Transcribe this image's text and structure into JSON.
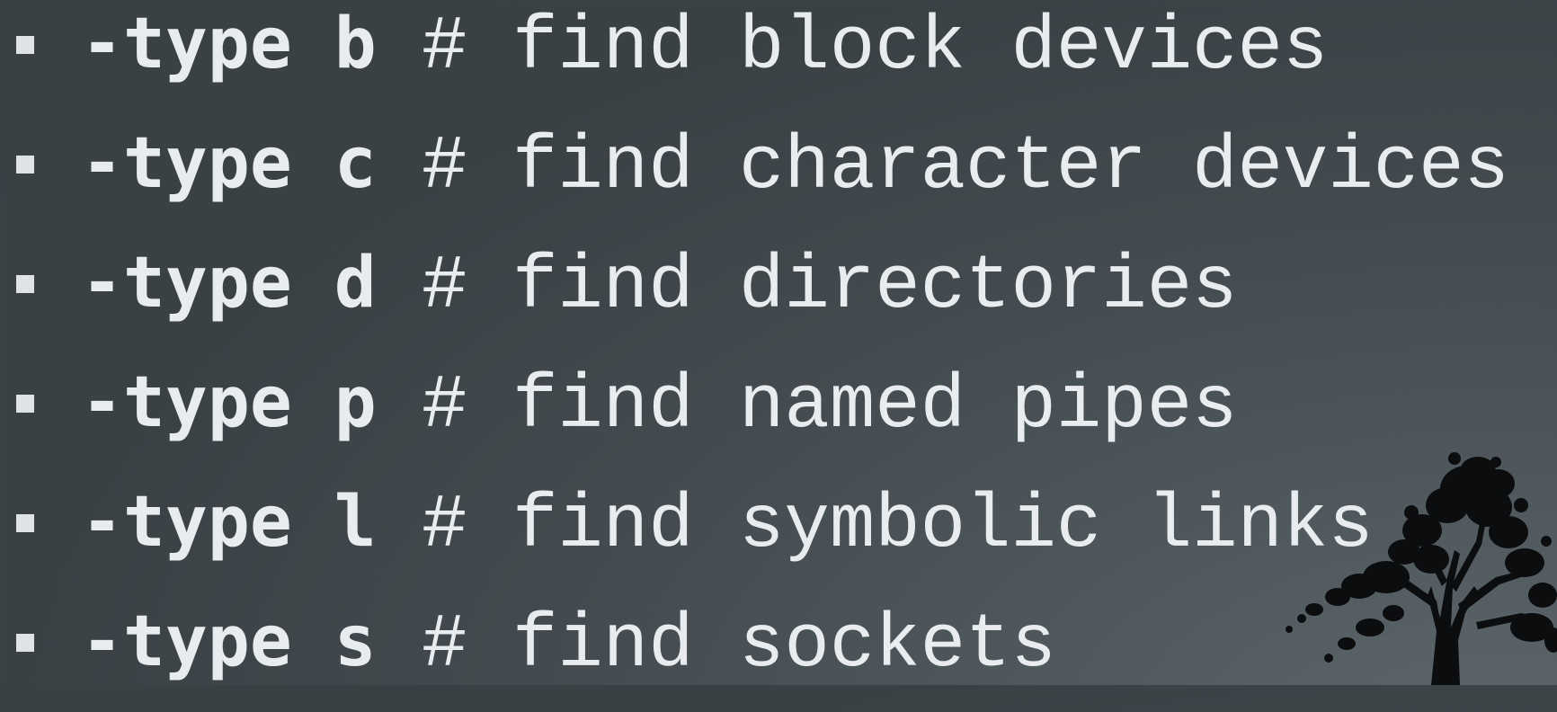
{
  "slide": {
    "items": [
      {
        "option": "-type b",
        "comment": "# find block devices"
      },
      {
        "option": "-type c",
        "comment": "# find character devices"
      },
      {
        "option": "-type d",
        "comment": "# find directories"
      },
      {
        "option": "-type p",
        "comment": "# find named pipes"
      },
      {
        "option": "-type l",
        "comment": "# find symbolic links"
      },
      {
        "option": "-type s",
        "comment": "# find sockets"
      }
    ]
  },
  "colors": {
    "background": "#434b50",
    "text": "#e9ecee",
    "tree": "#0b0d0e"
  },
  "decoration": {
    "tree_icon": "tree-silhouette"
  }
}
